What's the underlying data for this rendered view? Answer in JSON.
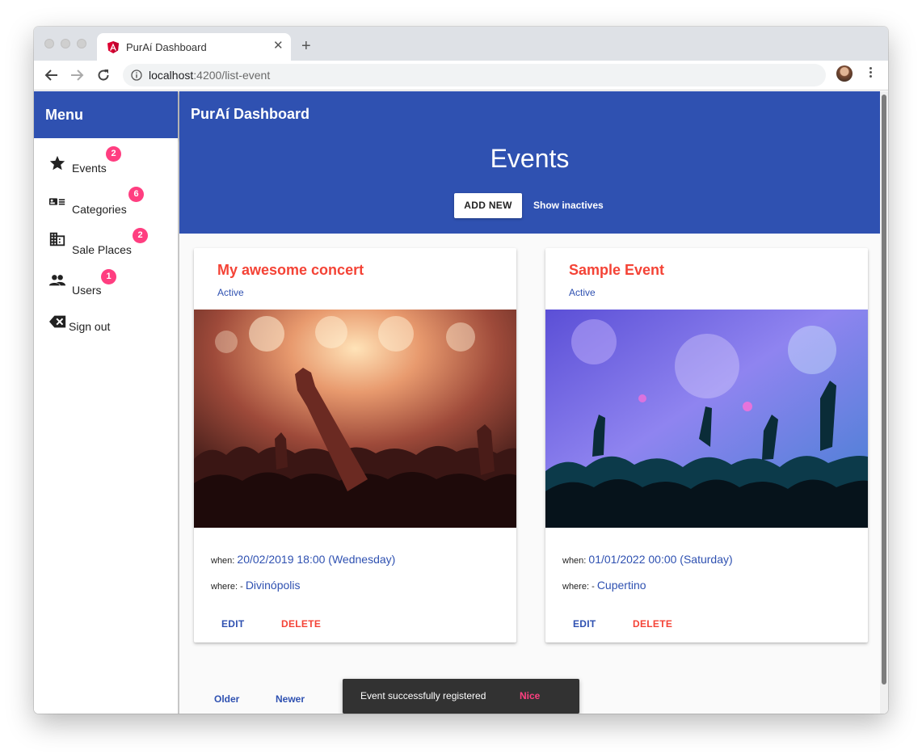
{
  "browser": {
    "tab_title": "PurAí Dashboard",
    "url_host": "localhost",
    "url_path": ":4200/list-event"
  },
  "sidebar": {
    "header": "Menu",
    "items": [
      {
        "label": "Events",
        "badge": "2",
        "icon": "star-icon"
      },
      {
        "label": "Categories",
        "badge": "6",
        "icon": "category-card-icon"
      },
      {
        "label": "Sale Places",
        "badge": "2",
        "icon": "building-icon"
      },
      {
        "label": "Users",
        "badge": "1",
        "icon": "people-icon"
      },
      {
        "label": "Sign out",
        "icon": "backspace-icon"
      }
    ]
  },
  "header": {
    "app_title": "PurAí Dashboard",
    "page_title": "Events",
    "add_new_label": "ADD NEW",
    "show_inactives_label": "Show inactives"
  },
  "events": [
    {
      "title": "My awesome concert",
      "status": "Active",
      "when_label": "when:",
      "when_value": "20/02/2019 18:00 (Wednesday)",
      "where_label": "where: -",
      "where_value": "Divinópolis",
      "edit_label": "EDIT",
      "delete_label": "DELETE"
    },
    {
      "title": "Sample Event",
      "status": "Active",
      "when_label": "when:",
      "when_value": "01/01/2022 00:00 (Saturday)",
      "where_label": "where: -",
      "where_value": "Cupertino",
      "edit_label": "EDIT",
      "delete_label": "DELETE"
    }
  ],
  "pagination": {
    "older_label": "Older",
    "newer_label": "Newer"
  },
  "snackbar": {
    "message": "Event successfully registered",
    "action": "Nice"
  },
  "colors": {
    "primary": "#2f51b1",
    "warn": "#f44336",
    "accent": "#ff3e80",
    "snackbar_bg": "#323232"
  }
}
